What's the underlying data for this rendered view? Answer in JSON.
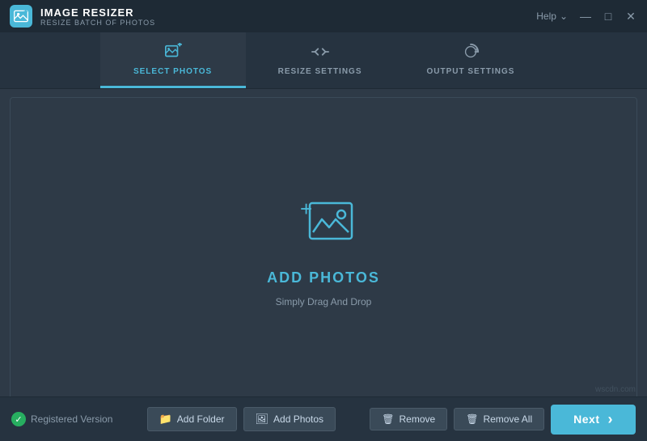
{
  "titleBar": {
    "appTitle": "IMAGE RESIZER",
    "appSubtitle": "RESIZE BATCH OF PHOTOS",
    "helpLabel": "Help",
    "chevron": "⌄",
    "minimizeBtn": "—",
    "maximizeBtn": "□",
    "closeBtn": "✕"
  },
  "tabs": [
    {
      "id": "select",
      "label": "SELECT PHOTOS",
      "active": true
    },
    {
      "id": "resize",
      "label": "RESIZE SETTINGS",
      "active": false
    },
    {
      "id": "output",
      "label": "OUTPUT SETTINGS",
      "active": false
    }
  ],
  "dropArea": {
    "mainLabel": "ADD PHOTOS",
    "subLabel": "Simply Drag And Drop"
  },
  "bottomLeft": {
    "addFolderLabel": "Add Folder",
    "addPhotosLabel": "Add Photos"
  },
  "bottomRight": {
    "removeLabel": "Remove",
    "removeAllLabel": "Remove All"
  },
  "statusBar": {
    "registeredLabel": "Registered Version"
  },
  "nextButton": {
    "label": "Next"
  },
  "watermark": "wscdn.com"
}
